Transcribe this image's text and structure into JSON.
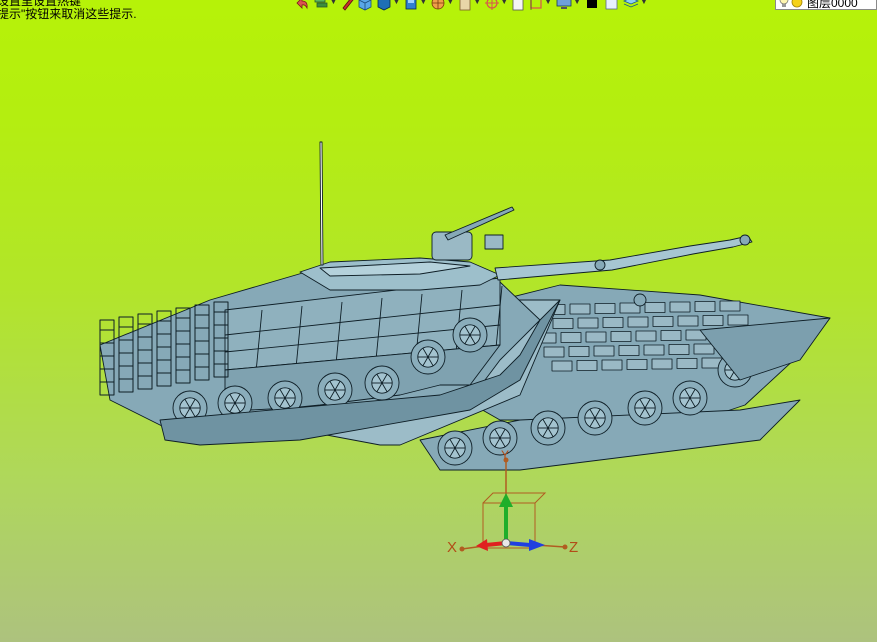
{
  "hints": {
    "line1": "设置里设置热键",
    "line2": "提示\"按钮来取消这些提示."
  },
  "toolbar": {
    "buttons": [
      {
        "name": "undo-icon",
        "color": "#d9534f"
      },
      {
        "name": "layers-icon",
        "color": "#3c8d3c"
      },
      {
        "name": "pencil-icon",
        "color": "#c9302c"
      },
      {
        "name": "cube-icon",
        "color": "#2f7fd1"
      },
      {
        "name": "solid-icon",
        "color": "#1f6fb5"
      },
      {
        "name": "box-icon",
        "color": "#2f7fd1"
      },
      {
        "name": "wheel-icon",
        "color": "#e07a1b"
      },
      {
        "name": "clipboard-icon",
        "color": "#7a5a2e"
      },
      {
        "name": "target-icon",
        "color": "#d9534f"
      },
      {
        "name": "page-icon",
        "color": "#888888"
      },
      {
        "name": "frame-icon",
        "color": "#d9534f"
      },
      {
        "name": "monitor-icon",
        "color": "#3a6fa8"
      },
      {
        "name": "black-square-icon",
        "color": "#000000"
      },
      {
        "name": "white-square-icon",
        "color": "#ffffff"
      },
      {
        "name": "stack-icon",
        "color": "#3a9ad9"
      }
    ]
  },
  "layer": {
    "label": "图层0000"
  },
  "axes": {
    "x_label": "X",
    "y_label": "Y",
    "z_label": "Z"
  },
  "model": {
    "fill": "#86a9b7",
    "stroke": "#0e1e26"
  }
}
